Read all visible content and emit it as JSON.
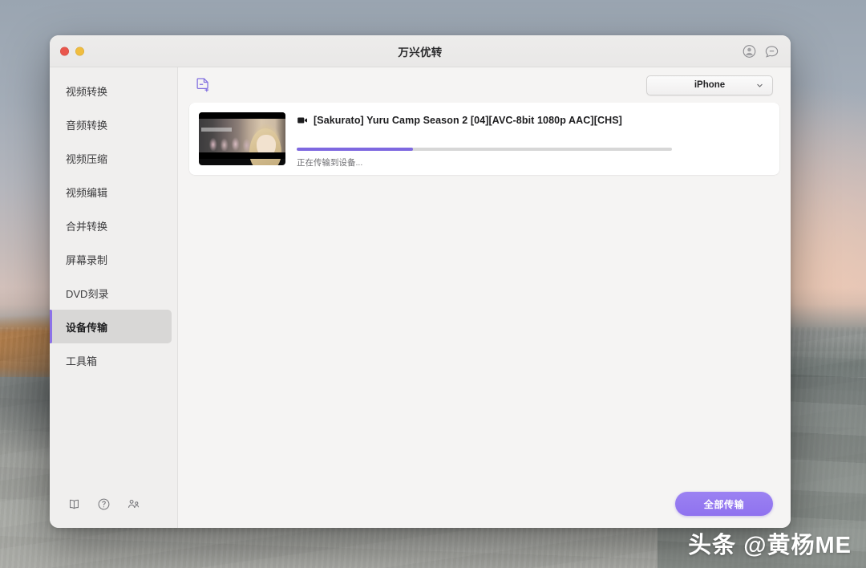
{
  "window": {
    "title": "万兴优转",
    "traffic_lights": [
      "close",
      "minimize",
      "maximize"
    ],
    "titlebar_icons": [
      "account-avatar-icon",
      "feedback-message-icon"
    ]
  },
  "sidebar": {
    "items": [
      {
        "label": "视频转换",
        "active": false
      },
      {
        "label": "音频转换",
        "active": false
      },
      {
        "label": "视频压缩",
        "active": false
      },
      {
        "label": "视频编辑",
        "active": false
      },
      {
        "label": "合并转换",
        "active": false
      },
      {
        "label": "屏幕录制",
        "active": false
      },
      {
        "label": "DVD刻录",
        "active": false
      },
      {
        "label": "设备传输",
        "active": true
      },
      {
        "label": "工具箱",
        "active": false
      }
    ],
    "footer_icons": [
      "book-icon",
      "help-icon",
      "community-icon"
    ],
    "accent_color": "#8c72e8"
  },
  "toolbar": {
    "add_file_icon": "add-file-icon",
    "device_select": {
      "value": "iPhone",
      "options": [
        "iPhone"
      ]
    }
  },
  "files": [
    {
      "name": "[Sakurato] Yuru Camp Season 2 [04][AVC-8bit 1080p AAC][CHS]",
      "type_icon": "video-icon",
      "status": "正在传输到设备...",
      "progress_percent": 31
    }
  ],
  "footer": {
    "transfer_all_label": "全部传输",
    "button_color": "#8f72ef"
  },
  "watermark": {
    "text": "头条 @黄杨ME"
  }
}
